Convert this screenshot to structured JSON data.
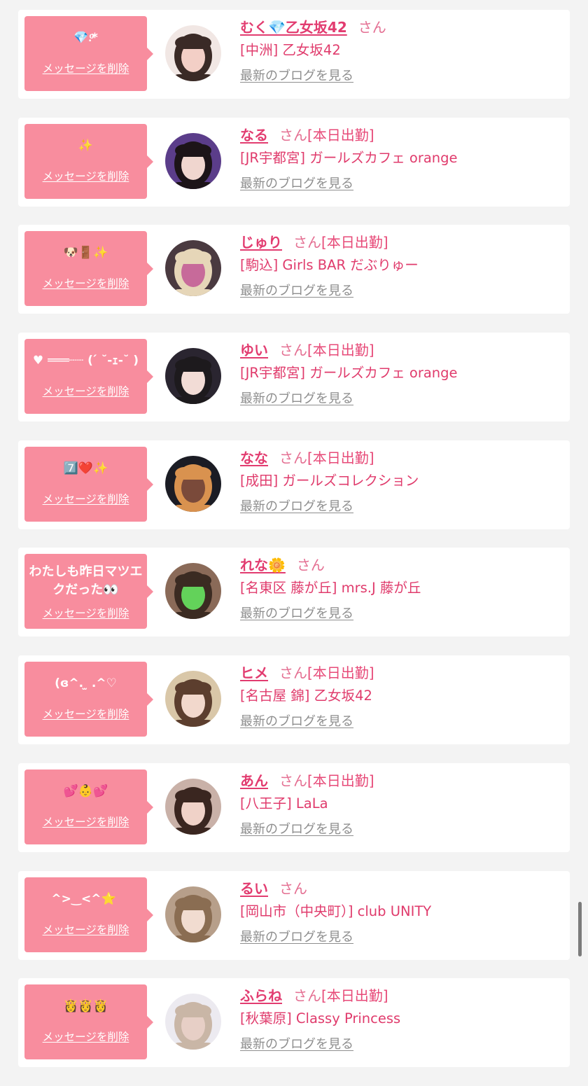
{
  "colors": {
    "background": "#f3f3f3",
    "bubble": "#f88d9e",
    "name": "#e23c70",
    "shop": "#e03b6c",
    "blog_link": "#8e8e8e"
  },
  "labels": {
    "delete_message": "メッセージを削除",
    "latest_blog": "最新のブログを見る"
  },
  "messages": [
    {
      "bubble": "💎.ͦ*",
      "name": "むく💎乙女坂42",
      "honorific": "さん",
      "status": "",
      "shop": "[中洲] 乙女坂42",
      "avatar_icon": "avatar-photo-icon",
      "avatar_colors": [
        "#f1e7e4",
        "#3a2a26",
        "#f3cfc6"
      ]
    },
    {
      "bubble": "✨",
      "name": "なる",
      "honorific": "さん",
      "status": "[本日出勤]",
      "shop": "[JR宇都宮] ガールズカフェ orange",
      "avatar_icon": "avatar-photo-icon",
      "avatar_colors": [
        "#5b3d8a",
        "#1c1418",
        "#f0d6cf"
      ]
    },
    {
      "bubble": "🐶🚪✨",
      "name": "じゅり",
      "honorific": "さん",
      "status": "[本日出勤]",
      "shop": "[駒込] Girls BAR だぶりゅー",
      "avatar_icon": "avatar-photo-icon",
      "avatar_colors": [
        "#4a3a40",
        "#e6d6b8",
        "#c76a9a"
      ]
    },
    {
      "bubble": "♥ ═══┈┈ ( ́ ˘-ｪ-˘ ) ",
      "name": "ゆい",
      "honorific": "さん",
      "status": "[本日出勤]",
      "shop": "[JR宇都宮] ガールズカフェ orange",
      "avatar_icon": "avatar-photo-icon",
      "avatar_colors": [
        "#2a2530",
        "#1d1a1d",
        "#f2dcd6"
      ]
    },
    {
      "bubble": "7️⃣❤️✨",
      "name": "なな",
      "honorific": "さん",
      "status": "[本日出勤]",
      "shop": "[成田] ガールズコレクション",
      "avatar_icon": "avatar-photo-icon",
      "avatar_colors": [
        "#1b1c24",
        "#d9924f",
        "#7a4a3a"
      ]
    },
    {
      "bubble": "わたしも昨日マツエクだった👀",
      "name": "れな🌼",
      "honorific": "さん",
      "status": "",
      "shop": "[名東区 藤が丘] mrs.J 藤が丘",
      "avatar_icon": "avatar-photo-icon",
      "avatar_colors": [
        "#8a6a58",
        "#3b2b22",
        "#63d25a"
      ]
    },
    {
      "bubble": "(ɞ^. ̫ .^♡",
      "name": "ヒメ",
      "honorific": "さん",
      "status": "[本日出勤]",
      "shop": "[名古屋 錦] 乙女坂42",
      "avatar_icon": "avatar-photo-icon",
      "avatar_colors": [
        "#d9c7a8",
        "#5c3e2e",
        "#f2d8cc"
      ]
    },
    {
      "bubble": "💕👶💕",
      "name": "あん",
      "honorific": "さん",
      "status": "[本日出勤]",
      "shop": "[八王子] LaLa",
      "avatar_icon": "avatar-photo-icon",
      "avatar_colors": [
        "#c9b1a8",
        "#3a2620",
        "#f0d2c8"
      ]
    },
    {
      "bubble": "^>‿<^⭐️ ͏",
      "name": "るい",
      "honorific": "さん",
      "status": "",
      "shop": "[岡山市（中央町）] club UNITY",
      "avatar_icon": "avatar-photo-icon",
      "avatar_colors": [
        "#b79f8a",
        "#8a6d52",
        "#f1dcd0"
      ]
    },
    {
      "bubble": "👸👸👸",
      "name": "ふらね",
      "honorific": "さん",
      "status": "[本日出勤]",
      "shop": "[秋葉原] Classy Princess",
      "avatar_icon": "avatar-photo-icon",
      "avatar_colors": [
        "#eceaf0",
        "#c9b6a6",
        "#e7cfc6"
      ]
    }
  ]
}
